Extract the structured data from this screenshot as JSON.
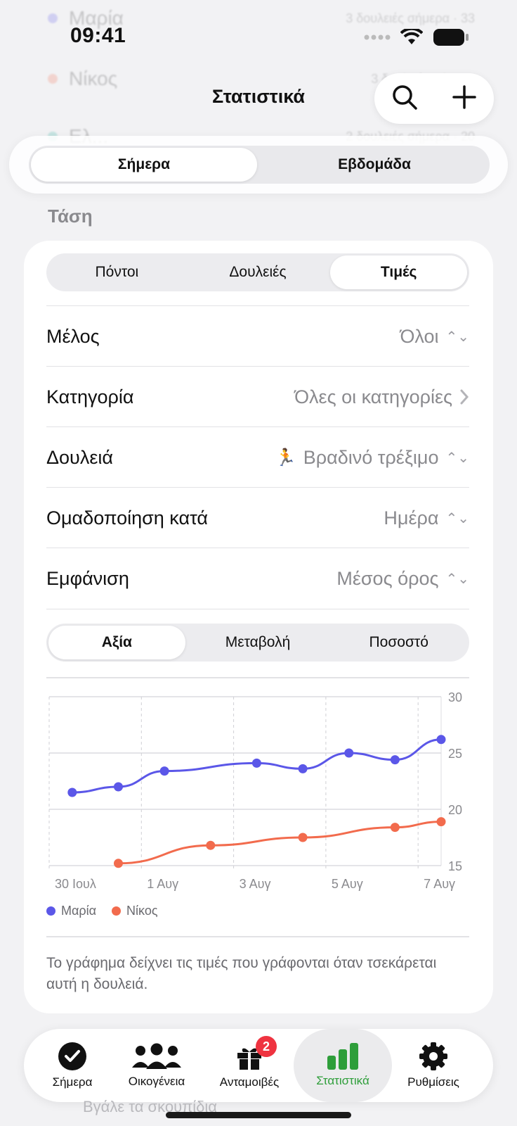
{
  "background_rows": [
    {
      "name": "Μαρία",
      "meta": "3 δουλειές σήμερα · 33",
      "color": "#5b57e8"
    },
    {
      "name": "Νίκος",
      "meta": "3 δουλειές σήμερα",
      "color": "#f26b4d"
    },
    {
      "name": "Ελ...",
      "meta": "2 δουλειές σήμερα · 20",
      "color": "#2bb3a3"
    }
  ],
  "status_bar": {
    "time": "09:41"
  },
  "header": {
    "title": "Στατιστικά"
  },
  "range_tabs": [
    {
      "label": "Σήμερα",
      "active": true
    },
    {
      "label": "Εβδομάδα",
      "active": false
    }
  ],
  "section": {
    "title": "Τάση"
  },
  "metric_tabs": [
    {
      "label": "Πόντοι",
      "active": false
    },
    {
      "label": "Δουλειές",
      "active": false
    },
    {
      "label": "Τιμές",
      "active": true
    }
  ],
  "filters": {
    "member": {
      "label": "Μέλος",
      "value": "Όλοι"
    },
    "category": {
      "label": "Κατηγορία",
      "value": "Όλες οι κατηγορίες"
    },
    "chore": {
      "label": "Δουλειά",
      "icon": "🏃",
      "value": "Βραδινό τρέξιμο"
    },
    "group_by": {
      "label": "Ομαδοποίηση κατά",
      "value": "Ημέρα"
    },
    "display": {
      "label": "Εμφάνιση",
      "value": "Μέσος όρος"
    }
  },
  "value_tabs": [
    {
      "label": "Αξία",
      "active": true
    },
    {
      "label": "Μεταβολή",
      "active": false
    },
    {
      "label": "Ποσοστό",
      "active": false
    }
  ],
  "chart_data": {
    "type": "line",
    "x_ticks": [
      "30 Ιουλ",
      "1 Αυγ",
      "3 Αυγ",
      "5 Αυγ",
      "7 Αυγ"
    ],
    "y_ticks": [
      30,
      25,
      20,
      15
    ],
    "ylim": [
      15,
      30
    ],
    "xlim": [
      0,
      8.5
    ],
    "grid": true,
    "legend_placement": "bottom-left",
    "series": [
      {
        "name": "Μαρία",
        "color": "#5b57e8",
        "points": [
          [
            0.5,
            21.5
          ],
          [
            1.5,
            22
          ],
          [
            2.5,
            23.4
          ],
          [
            4.5,
            24.1
          ],
          [
            5.5,
            23.6
          ],
          [
            6.5,
            25
          ],
          [
            7.5,
            24.4
          ],
          [
            8.5,
            26.2
          ]
        ]
      },
      {
        "name": "Νίκος",
        "color": "#f26b4d",
        "points": [
          [
            1.5,
            15.2
          ],
          [
            3.5,
            16.8
          ],
          [
            5.5,
            17.5
          ],
          [
            7.5,
            18.4
          ],
          [
            8.5,
            18.9
          ]
        ]
      }
    ]
  },
  "note": "Το γράφημα δείχνει τις τιμές που γράφονται όταν τσεκάρεται αυτή η δουλειά.",
  "tabbar": {
    "items": [
      {
        "label": "Σήμερα",
        "icon": "checkmark-circle-icon",
        "active": false
      },
      {
        "label": "Οικογένεια",
        "icon": "people-icon",
        "active": false
      },
      {
        "label": "Ανταμοιβές",
        "icon": "gift-icon",
        "active": false,
        "badge": "2"
      },
      {
        "label": "Στατιστικά",
        "icon": "bar-chart-icon",
        "active": true
      },
      {
        "label": "Ρυθμίσεις",
        "icon": "gear-icon",
        "active": false
      }
    ]
  },
  "ghost_text": "Βγάλε τα σκουπίδια"
}
